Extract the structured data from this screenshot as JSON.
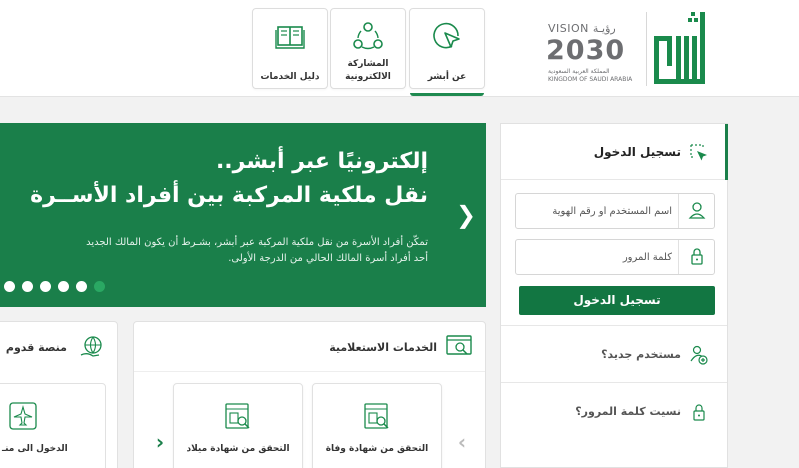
{
  "header": {
    "vision_logo": {
      "vision_text": "VISION رؤيـة",
      "year_text": "2030",
      "kingdom_arabic": "المملكة العربية السعودية",
      "kingdom_english": "KINGDOM OF SAUDI ARABIA"
    },
    "absher_logo_text": "أبشر",
    "nav_cards": [
      {
        "label": "عن أبشر",
        "icon": "cursor-click-icon",
        "active": true
      },
      {
        "label_line1": "المشاركة",
        "label_line2": "الالكترونية",
        "icon": "share-network-icon"
      },
      {
        "label": "دليل الخدمات",
        "icon": "open-book-icon"
      }
    ]
  },
  "hero": {
    "title_line1": "إلكترونيًا عبر أبشر..",
    "title_line2": "نقل ملكية المركبة بين أفراد الأســرة",
    "description_line1": "تمكّن أفراد الأسرة من نقل ملكية المركبة عبر أبشر، بشـرط أن يكون المالك الجديد",
    "description_line2": "أحد أفراد أسرة المالك الحالي من الدرجة الأولى.",
    "next_arrow": "❯",
    "slide_count": 6,
    "active_slide": 6
  },
  "login": {
    "title": "تسجيل الدخول",
    "username_placeholder": "اسم المستخدم أو رقم الهوية",
    "password_placeholder": "كلمة المرور",
    "submit_label": "تسجيل الدخول",
    "new_user_label": "مستخدم جديد؟",
    "forgot_password_label": "نسيت كلمة المرور؟"
  },
  "services": {
    "title": "الخدمات الاستعلامية",
    "cards": [
      {
        "label": "التحقق من شهادة وفاة",
        "icon": "certificate-search-icon"
      },
      {
        "label": "التحقق من شهادة ميلاد",
        "icon": "certificate-search-icon"
      }
    ],
    "prev_arrow": "‹",
    "next_arrow": "‹"
  },
  "qudoom": {
    "title": "منصة قدوم",
    "card_label": "الدخول الى منـ",
    "icon": "airplane-icon"
  },
  "colors": {
    "brand_green": "#1a7f4a",
    "button_green": "#127642",
    "accent_light_green": "#2aa863"
  }
}
